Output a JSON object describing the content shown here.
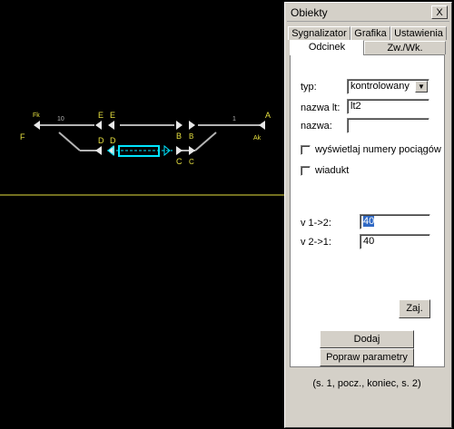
{
  "diagram": {
    "labels": {
      "fk": "Fk",
      "f": "F",
      "ten": "10",
      "e1": "E",
      "e2": "E",
      "d1": "D",
      "d2": "D",
      "b1": "B",
      "b2": "B",
      "c1": "C",
      "c2": "C",
      "one": "1",
      "a": "A",
      "ak": "Ak"
    },
    "colors": {
      "track": "#b4b4b4",
      "label": "#e6e040",
      "selection": "#00e5ff",
      "ground_line": "#e6e040"
    }
  },
  "window": {
    "title": "Obiekty",
    "close_label": "X",
    "tabs_top": [
      "Sygnalizator",
      "Grafika",
      "Ustawienia"
    ],
    "tabs_bottom": [
      "Odcinek",
      "Zw./Wk."
    ],
    "fields": {
      "typ_label": "typ:",
      "typ_value": "kontrolowany",
      "nazwa_lt_label": "nazwa lt:",
      "nazwa_lt_value": "lt2",
      "nazwa_label": "nazwa:",
      "nazwa_value": ""
    },
    "checks": {
      "numbers_label": "wyświetlaj numery pociągów",
      "wiadukt_label": "wiadukt"
    },
    "speeds": {
      "v12_label": "v 1->2:",
      "v12_value": "40",
      "v21_label": "v 2->1:",
      "v21_value": "40"
    },
    "buttons": {
      "zaj": "Zaj.",
      "dodaj": "Dodaj",
      "popraw": "Popraw parametry"
    },
    "hint": "(s. 1, pocz., koniec, s. 2)"
  }
}
